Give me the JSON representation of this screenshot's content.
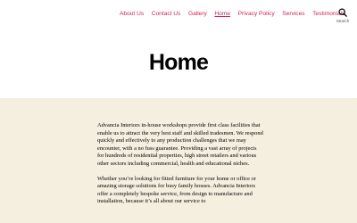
{
  "nav": {
    "items": [
      {
        "label": "About Us"
      },
      {
        "label": "Contact Us"
      },
      {
        "label": "Gallery"
      },
      {
        "label": "Home",
        "current": true
      },
      {
        "label": "Privacy Policy"
      },
      {
        "label": "Services"
      },
      {
        "label": "Testimonials"
      }
    ],
    "search_label": "Search",
    "search_icon": "search-icon"
  },
  "page": {
    "title": "Home"
  },
  "content": {
    "paragraphs": [
      "Advancia Interiors in-house workshops provide first class facilities that enable us to attract the very best staff and skilled tradesmen. We respond quickly and effectively to any production challenges that we may encounter, with a no fuss guarantee. Providing a vast array of projects for hundreds of residential properties, high street retailers and various other sectors including commercial, health and educational niches.",
      "Whether you’re looking for fitted furniture for your home or office or amazing storage solutions for busy family houses. Advancia Interiors offer a completely bespoke service, from design to manufacture and installation, because it’s all about our service to"
    ]
  },
  "colors": {
    "accent": "#cd2653",
    "content_bg": "#f5efe0",
    "header_bg": "#ffffff"
  }
}
